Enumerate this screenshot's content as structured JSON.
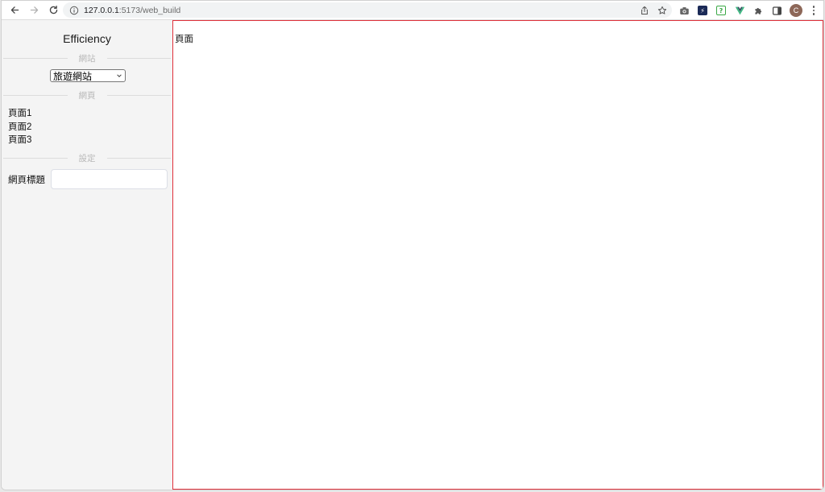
{
  "browser": {
    "url_host": "127.0.0.1",
    "url_rest": ":5173/web_build",
    "profile_initial": "C",
    "icons": [
      "back-icon",
      "forward-icon",
      "reload-icon",
      "site-info-icon",
      "share-icon",
      "bookmark-star-icon",
      "camera-extension-icon",
      "extension-icon",
      "extension-icon",
      "vue-devtools-icon",
      "puzzle-extensions-icon",
      "side-panel-icon",
      "avatar",
      "menu-kebab-icon"
    ]
  },
  "sidebar": {
    "title": "Efficiency",
    "website_section_label": "網站",
    "website_select_value": "旅遊網站",
    "pages_section_label": "網頁",
    "pages": [
      "頁面1",
      "頁面2",
      "頁面3"
    ],
    "settings_section_label": "設定",
    "page_title_label": "網頁標題",
    "page_title_value": ""
  },
  "main": {
    "content_text": "頁面"
  },
  "colors": {
    "sidebar_bg": "#f4f4f4",
    "main_border": "#e0303a",
    "divider_label": "#b8b8b8",
    "avatar_bg": "#8d6758"
  }
}
